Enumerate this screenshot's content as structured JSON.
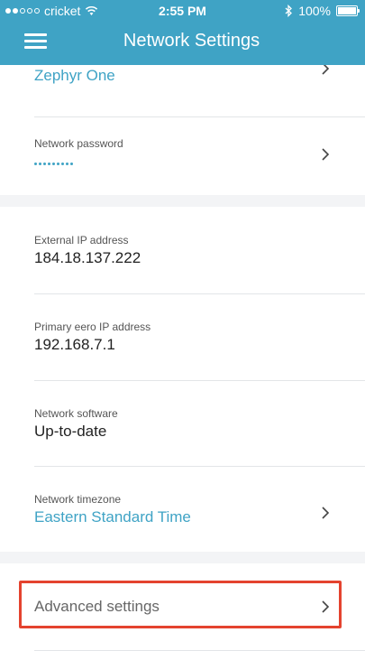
{
  "status_bar": {
    "carrier": "cricket",
    "time": "2:55 PM",
    "battery": "100%",
    "battery_level": 1.0,
    "signal_bars_filled": 2
  },
  "header": {
    "title": "Network Settings",
    "menu_icon": "hamburger-menu-icon"
  },
  "network": {
    "name": "Zephyr One",
    "password_label": "Network password"
  },
  "info": {
    "external_ip_label": "External IP address",
    "external_ip_value": "184.18.137.222",
    "primary_ip_label": "Primary eero IP address",
    "primary_ip_value": "192.168.7.1",
    "software_label": "Network software",
    "software_value": "Up-to-date",
    "timezone_label": "Network timezone",
    "timezone_value": "Eastern Standard Time"
  },
  "advanced": {
    "label": "Advanced settings"
  },
  "colors": {
    "accent": "#3fa3c5",
    "highlight": "#e4432f"
  }
}
